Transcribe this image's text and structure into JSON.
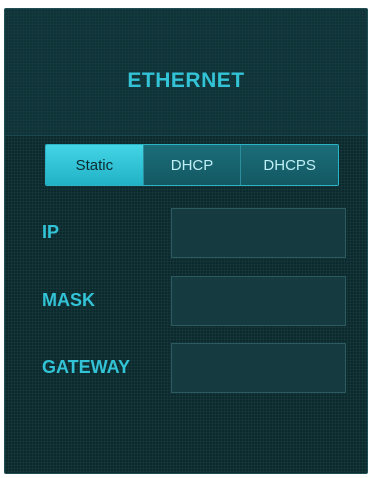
{
  "panel": {
    "title": "ETHERNET"
  },
  "mode_selector": {
    "selected": "Static",
    "options": [
      "Static",
      "DHCP",
      "DHCPS"
    ]
  },
  "fields": {
    "ip": {
      "label": "IP",
      "value": ""
    },
    "mask": {
      "label": "MASK",
      "value": ""
    },
    "gateway": {
      "label": "GATEWAY",
      "value": ""
    }
  },
  "colors": {
    "accent": "#32c3d6",
    "panel_bg": "#0a2a2e",
    "active_segment": "#3ccbdd"
  }
}
